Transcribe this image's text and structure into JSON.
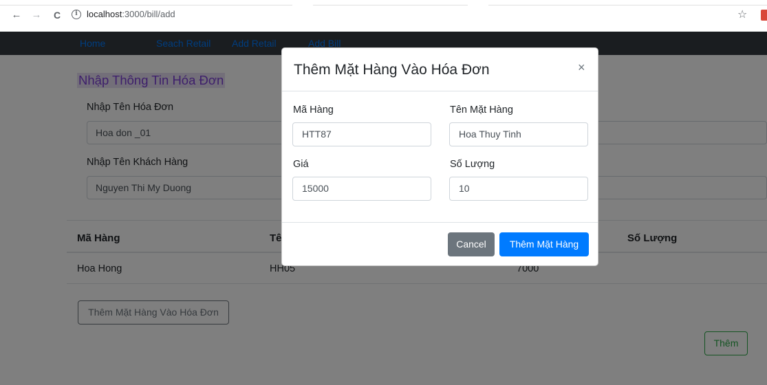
{
  "browser": {
    "url_host": "localhost",
    "url_rest": ":3000/bill/add",
    "back_glyph": "←",
    "forward_glyph": "→",
    "reload_glyph": "C",
    "info_glyph": "i",
    "star_glyph": "☆"
  },
  "navbar": {
    "links": [
      "Home",
      "Seach Retail",
      "Add Retail",
      "Add Bill"
    ]
  },
  "form": {
    "title": "Nhập Thông Tin Hóa Đơn",
    "bill_name_label": "Nhập Tên Hóa Đơn",
    "bill_name_value": "Hoa don _01",
    "customer_name_label": "Nhập Tên Khách Hàng",
    "customer_name_value": "Nguyen Thi My Duong"
  },
  "table": {
    "headers": [
      "Mã Hàng",
      "Tê",
      "Số Lượng"
    ],
    "rows": [
      {
        "code": "Hoa Hong",
        "name": "HH05",
        "price": "7000"
      }
    ]
  },
  "buttons": {
    "add_item_to_bill": "Thêm Mặt Hàng Vào Hóa Đơn",
    "submit": "Thêm"
  },
  "modal": {
    "title": "Thêm Mặt Hàng Vào Hóa Đơn",
    "close_glyph": "×",
    "code_label": "Mã Hàng",
    "code_value": "HTT87",
    "name_label": "Tên Mặt Hàng",
    "name_value": "Hoa Thuy Tinh",
    "price_label": "Giá",
    "price_value": "15000",
    "qty_label": "Số Lượng",
    "qty_value": "10",
    "cancel_label": "Cancel",
    "confirm_label": "Thêm Mặt Hàng"
  },
  "colors": {
    "navbar_bg": "#343a40",
    "link": "#007bff",
    "primary": "#007bff",
    "secondary": "#6c757d",
    "success": "#28a745",
    "title_text": "#7c3fd6"
  }
}
